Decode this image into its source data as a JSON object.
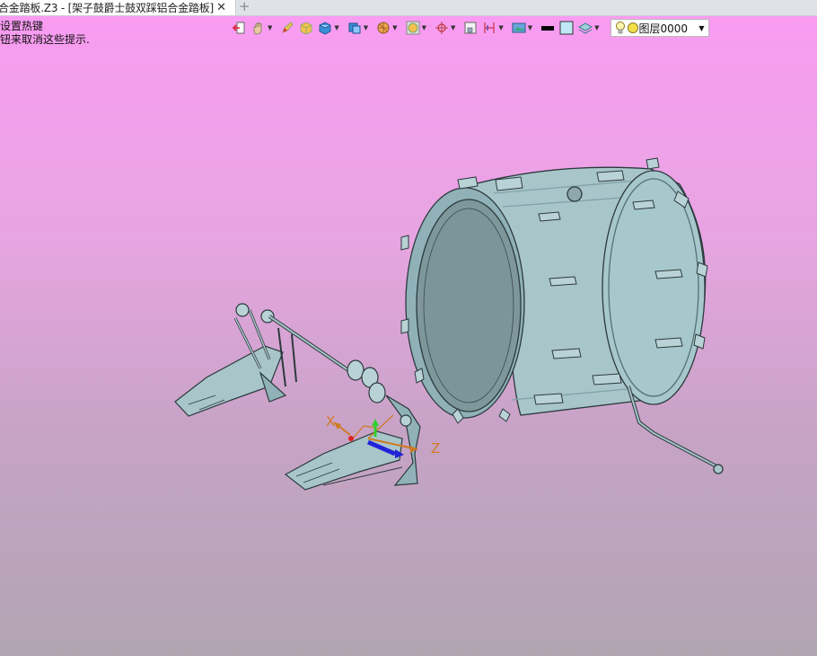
{
  "tab": {
    "title": "合金踏板.Z3 - [架子鼓爵士鼓双踩铝合金踏板]",
    "close": "✕",
    "new_tab": "+"
  },
  "hint": {
    "line1": "设置热键",
    "line2": "钮来取消这些提示."
  },
  "layer_select": {
    "value": "图层0000"
  },
  "axes": {
    "x": "X",
    "z": "Z"
  },
  "colors": {
    "model": "#9ec0c4",
    "model_edge": "#2c3a3d",
    "bg_top": "#f99cf2",
    "bg_bottom": "#b1a5b2",
    "axis_orange": "#d07a22",
    "axis_blue": "#2222d8",
    "axis_green": "#2fcf2f"
  }
}
